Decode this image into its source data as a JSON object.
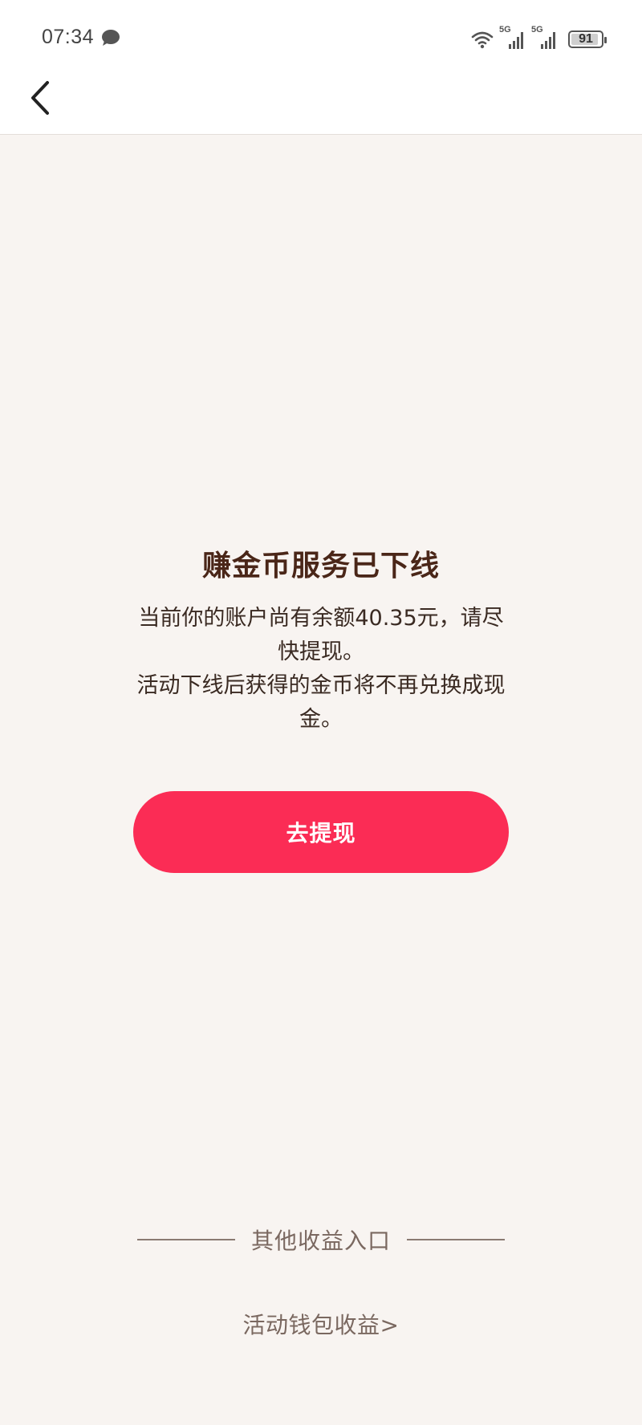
{
  "status_bar": {
    "time": "07:34",
    "network_1": "5G",
    "network_2": "5G",
    "battery": "91",
    "battery_percent": 91
  },
  "header": {
    "back_icon": "chevron-left-icon"
  },
  "main": {
    "title": "赚金币服务已下线",
    "desc_line_1": "当前你的账户尚有余额40.35元，请尽快提现。",
    "desc_line_2": "活动下线后获得的金币将不再兑换成现金。",
    "withdraw_button": "去提现"
  },
  "other": {
    "title": "其他收益入口",
    "wallet_link": "活动钱包收益>"
  },
  "colors": {
    "background": "#f8f4f1",
    "title": "#4a2618",
    "button": "#fb2c55",
    "muted_text": "#7a6860"
  }
}
